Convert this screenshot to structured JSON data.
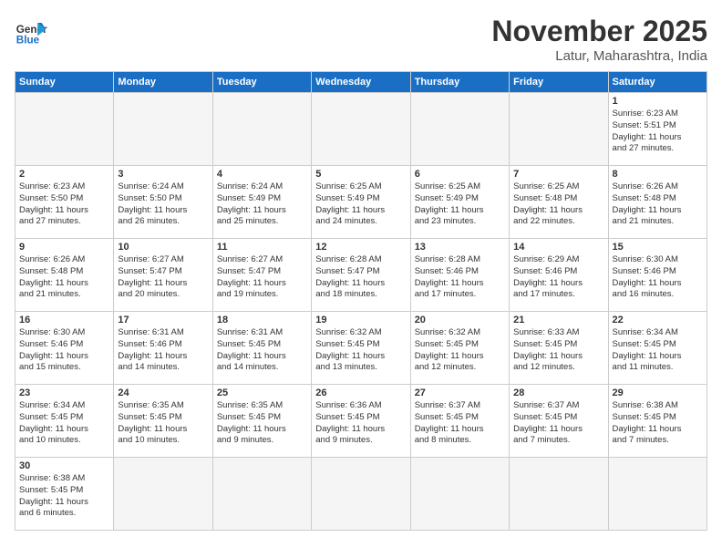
{
  "header": {
    "logo_general": "General",
    "logo_blue": "Blue",
    "month_title": "November 2025",
    "location": "Latur, Maharashtra, India"
  },
  "days_of_week": [
    "Sunday",
    "Monday",
    "Tuesday",
    "Wednesday",
    "Thursday",
    "Friday",
    "Saturday"
  ],
  "weeks": [
    [
      {
        "day": "",
        "content": ""
      },
      {
        "day": "",
        "content": ""
      },
      {
        "day": "",
        "content": ""
      },
      {
        "day": "",
        "content": ""
      },
      {
        "day": "",
        "content": ""
      },
      {
        "day": "",
        "content": ""
      },
      {
        "day": "1",
        "content": "Sunrise: 6:23 AM\nSunset: 5:51 PM\nDaylight: 11 hours\nand 27 minutes."
      }
    ],
    [
      {
        "day": "2",
        "content": "Sunrise: 6:23 AM\nSunset: 5:50 PM\nDaylight: 11 hours\nand 27 minutes."
      },
      {
        "day": "3",
        "content": "Sunrise: 6:24 AM\nSunset: 5:50 PM\nDaylight: 11 hours\nand 26 minutes."
      },
      {
        "day": "4",
        "content": "Sunrise: 6:24 AM\nSunset: 5:49 PM\nDaylight: 11 hours\nand 25 minutes."
      },
      {
        "day": "5",
        "content": "Sunrise: 6:25 AM\nSunset: 5:49 PM\nDaylight: 11 hours\nand 24 minutes."
      },
      {
        "day": "6",
        "content": "Sunrise: 6:25 AM\nSunset: 5:49 PM\nDaylight: 11 hours\nand 23 minutes."
      },
      {
        "day": "7",
        "content": "Sunrise: 6:25 AM\nSunset: 5:48 PM\nDaylight: 11 hours\nand 22 minutes."
      },
      {
        "day": "8",
        "content": "Sunrise: 6:26 AM\nSunset: 5:48 PM\nDaylight: 11 hours\nand 21 minutes."
      }
    ],
    [
      {
        "day": "9",
        "content": "Sunrise: 6:26 AM\nSunset: 5:48 PM\nDaylight: 11 hours\nand 21 minutes."
      },
      {
        "day": "10",
        "content": "Sunrise: 6:27 AM\nSunset: 5:47 PM\nDaylight: 11 hours\nand 20 minutes."
      },
      {
        "day": "11",
        "content": "Sunrise: 6:27 AM\nSunset: 5:47 PM\nDaylight: 11 hours\nand 19 minutes."
      },
      {
        "day": "12",
        "content": "Sunrise: 6:28 AM\nSunset: 5:47 PM\nDaylight: 11 hours\nand 18 minutes."
      },
      {
        "day": "13",
        "content": "Sunrise: 6:28 AM\nSunset: 5:46 PM\nDaylight: 11 hours\nand 17 minutes."
      },
      {
        "day": "14",
        "content": "Sunrise: 6:29 AM\nSunset: 5:46 PM\nDaylight: 11 hours\nand 17 minutes."
      },
      {
        "day": "15",
        "content": "Sunrise: 6:30 AM\nSunset: 5:46 PM\nDaylight: 11 hours\nand 16 minutes."
      }
    ],
    [
      {
        "day": "16",
        "content": "Sunrise: 6:30 AM\nSunset: 5:46 PM\nDaylight: 11 hours\nand 15 minutes."
      },
      {
        "day": "17",
        "content": "Sunrise: 6:31 AM\nSunset: 5:46 PM\nDaylight: 11 hours\nand 14 minutes."
      },
      {
        "day": "18",
        "content": "Sunrise: 6:31 AM\nSunset: 5:45 PM\nDaylight: 11 hours\nand 14 minutes."
      },
      {
        "day": "19",
        "content": "Sunrise: 6:32 AM\nSunset: 5:45 PM\nDaylight: 11 hours\nand 13 minutes."
      },
      {
        "day": "20",
        "content": "Sunrise: 6:32 AM\nSunset: 5:45 PM\nDaylight: 11 hours\nand 12 minutes."
      },
      {
        "day": "21",
        "content": "Sunrise: 6:33 AM\nSunset: 5:45 PM\nDaylight: 11 hours\nand 12 minutes."
      },
      {
        "day": "22",
        "content": "Sunrise: 6:34 AM\nSunset: 5:45 PM\nDaylight: 11 hours\nand 11 minutes."
      }
    ],
    [
      {
        "day": "23",
        "content": "Sunrise: 6:34 AM\nSunset: 5:45 PM\nDaylight: 11 hours\nand 10 minutes."
      },
      {
        "day": "24",
        "content": "Sunrise: 6:35 AM\nSunset: 5:45 PM\nDaylight: 11 hours\nand 10 minutes."
      },
      {
        "day": "25",
        "content": "Sunrise: 6:35 AM\nSunset: 5:45 PM\nDaylight: 11 hours\nand 9 minutes."
      },
      {
        "day": "26",
        "content": "Sunrise: 6:36 AM\nSunset: 5:45 PM\nDaylight: 11 hours\nand 9 minutes."
      },
      {
        "day": "27",
        "content": "Sunrise: 6:37 AM\nSunset: 5:45 PM\nDaylight: 11 hours\nand 8 minutes."
      },
      {
        "day": "28",
        "content": "Sunrise: 6:37 AM\nSunset: 5:45 PM\nDaylight: 11 hours\nand 7 minutes."
      },
      {
        "day": "29",
        "content": "Sunrise: 6:38 AM\nSunset: 5:45 PM\nDaylight: 11 hours\nand 7 minutes."
      }
    ],
    [
      {
        "day": "30",
        "content": "Sunrise: 6:38 AM\nSunset: 5:45 PM\nDaylight: 11 hours\nand 6 minutes."
      },
      {
        "day": "",
        "content": ""
      },
      {
        "day": "",
        "content": ""
      },
      {
        "day": "",
        "content": ""
      },
      {
        "day": "",
        "content": ""
      },
      {
        "day": "",
        "content": ""
      },
      {
        "day": "",
        "content": ""
      }
    ]
  ]
}
